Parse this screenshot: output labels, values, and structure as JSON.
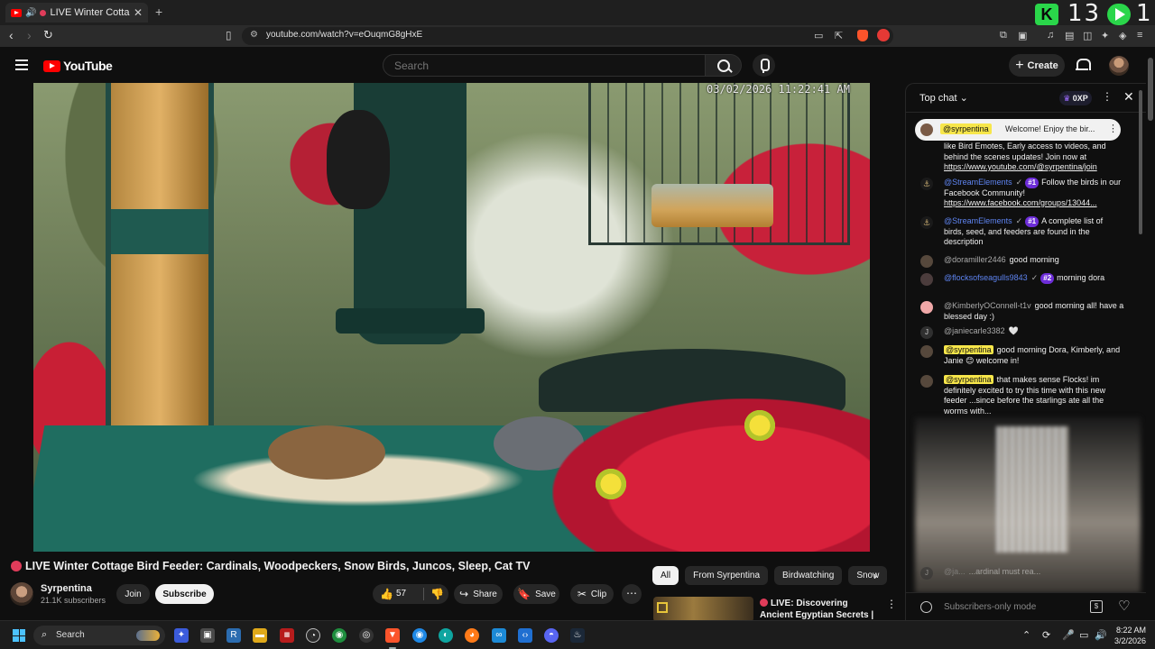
{
  "browser": {
    "tab_title": "LIVE Winter Cottage Bird F",
    "url": "youtube.com/watch?v=eOuqmG8gHxE",
    "overlay_counter": "13",
    "overlay_counter_right": "1"
  },
  "header": {
    "logo_text": "YouTube",
    "search_placeholder": "Search",
    "create_label": "Create"
  },
  "video": {
    "timestamp": "03/02/2026 11:22:41 AM"
  },
  "info": {
    "title": "LIVE Winter Cottage Bird Feeder: Cardinals, Woodpeckers, Snow Birds, Juncos, Sleep, Cat TV",
    "channel": "Syrpentina",
    "subscribers": "21.1K subscribers",
    "join": "Join",
    "subscribe": "Subscribe",
    "likes": "57",
    "share": "Share",
    "save": "Save",
    "clip": "Clip"
  },
  "chips": [
    "All",
    "From Syrpentina",
    "Birdwatching",
    "Snow"
  ],
  "recommendation": {
    "title": "LIVE: Discovering Ancient Egyptian Secrets | Lost ..."
  },
  "chat": {
    "mode_label": "Top chat",
    "points_badge": "0XP",
    "pinned": {
      "author": "@syrpentina",
      "text": "Welcome! Enjoy the bir..."
    },
    "messages": [
      {
        "text_pre": "like Bird Emotes, Early access to videos, and behind the scenes updates! Join now at ",
        "link": "https://www.youtube.com/@syrpentina/join"
      },
      {
        "author": "@StreamElements",
        "badge": "#1",
        "text_pre": "Follow the birds in our Facebook Community! ",
        "link": "https://www.facebook.com/groups/13044..."
      },
      {
        "author": "@StreamElements",
        "badge": "#1",
        "text_pre": "A complete list of birds, seed, and feeders are found in the description"
      },
      {
        "author": "@doramiller2446",
        "text_pre": "good morning"
      },
      {
        "author": "@flocksofseagulls9843",
        "badge": "#2",
        "text_pre": "morning dora"
      },
      {
        "author": "@KimberlyOConnell-t1v",
        "text_pre": "good morning all! have a blessed day :)"
      },
      {
        "author": "@janiecarle3382",
        "text_pre": "🤍"
      },
      {
        "author": "@syrpentina",
        "text_pre": "good morning Dora, Kimberly, and Janie 😊 welcome in!"
      },
      {
        "author": "@syrpentina",
        "text_pre": "that makes sense Flocks! im definitely excited to try this time with this new feeder ...since before the starlings ate all the worms with..."
      },
      {
        "author": "@ja...",
        "text_pre": "...ardinal must rea..."
      }
    ],
    "input_placeholder": "Subscribers-only mode",
    "avatar_initial": "J"
  },
  "taskbar": {
    "search_label": "Search",
    "time": "8:22 AM",
    "date": "3/2/2026"
  }
}
